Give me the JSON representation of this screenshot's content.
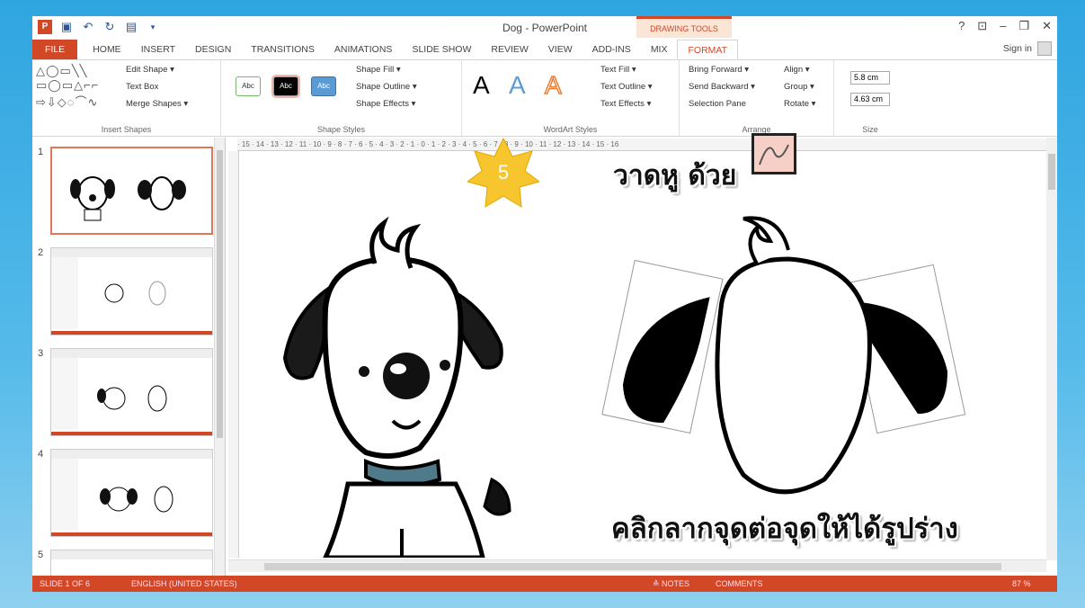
{
  "window": {
    "title": "Dog - PowerPoint",
    "context_tab_group": "DRAWING TOOLS",
    "sign_in": "Sign in"
  },
  "tabs": [
    "FILE",
    "HOME",
    "INSERT",
    "DESIGN",
    "TRANSITIONS",
    "ANIMATIONS",
    "SLIDE SHOW",
    "REVIEW",
    "VIEW",
    "ADD-INS",
    "MIX",
    "FORMAT"
  ],
  "ribbon": {
    "insert_shapes": {
      "label": "Insert Shapes",
      "edit_shape": "Edit Shape ▾",
      "text_box": "Text Box",
      "merge_shapes": "Merge Shapes ▾"
    },
    "shape_styles": {
      "label": "Shape Styles",
      "swatch": "Abc",
      "fill": "Shape Fill ▾",
      "outline": "Shape Outline ▾",
      "effects": "Shape Effects ▾"
    },
    "wordart_styles": {
      "label": "WordArt Styles",
      "letter": "A",
      "text_fill": "Text Fill ▾",
      "text_outline": "Text Outline ▾",
      "text_effects": "Text Effects ▾"
    },
    "arrange": {
      "label": "Arrange",
      "bring_forward": "Bring Forward ▾",
      "send_backward": "Send Backward ▾",
      "selection_pane": "Selection Pane",
      "align": "Align ▾",
      "group": "Group ▾",
      "rotate": "Rotate ▾"
    },
    "size": {
      "label": "Size",
      "height": "5.8 cm",
      "width": "4.63 cm"
    }
  },
  "slides": [
    {
      "num": "1"
    },
    {
      "num": "2"
    },
    {
      "num": "3"
    },
    {
      "num": "4"
    },
    {
      "num": "5"
    }
  ],
  "ruler_ticks": "· 15 · 14 · 13 · 12 · 11 · 10 · 9 · 8 · 7 · 6 · 5 · 4 · 3 · 2 · 1 · 0 · 1 · 2 · 3 · 4 · 5 · 6 · 7 · 8 · 9 · 10 · 11 · 12 · 13 · 14 · 15 · 16",
  "annotation": {
    "step": "5",
    "draw_ear_text": "วาดหู ด้วย",
    "instruction_text": "คลิกลากจุดต่อจุดให้ได้รูปร่าง"
  },
  "status_bar": {
    "slide_of": "SLIDE 1 OF 6",
    "language": "ENGLISH (UNITED STATES)",
    "notes": "≙ NOTES",
    "comments": "COMMENTS",
    "zoom": "87 %"
  },
  "colors": {
    "accent": "#d24726",
    "background": "#2fa5e0"
  }
}
